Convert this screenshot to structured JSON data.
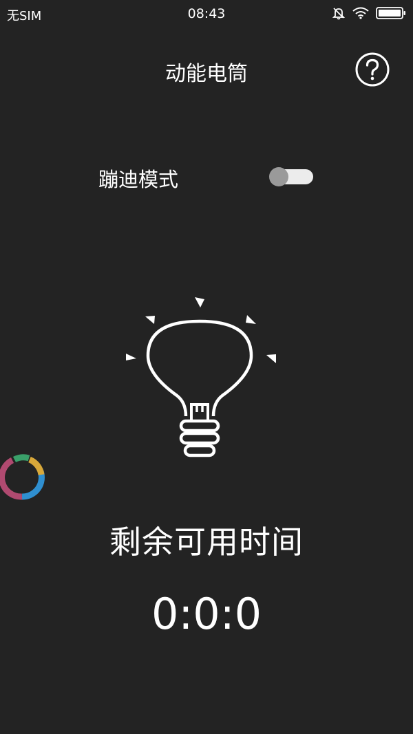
{
  "status_bar": {
    "carrier": "无SIM",
    "time": "08:43",
    "icons": [
      "mute-bell-icon",
      "wifi-icon",
      "battery-icon"
    ]
  },
  "header": {
    "title": "动能电筒",
    "help_icon": "help-circle-icon"
  },
  "disco_mode": {
    "label": "蹦迪模式",
    "enabled": false
  },
  "bulb": {
    "icon": "lightbulb-icon"
  },
  "remaining": {
    "label": "剩余可用时间",
    "value": "0:0:0"
  },
  "floating_widget": {
    "icon": "ring-widget-icon",
    "colors": [
      "#2f8fd0",
      "#d8a83a",
      "#3aa06a",
      "#b04a70"
    ]
  },
  "colors": {
    "background": "#232323",
    "foreground": "#ffffff",
    "toggle_track": "#ececec",
    "toggle_knob": "#9a9a9a"
  }
}
